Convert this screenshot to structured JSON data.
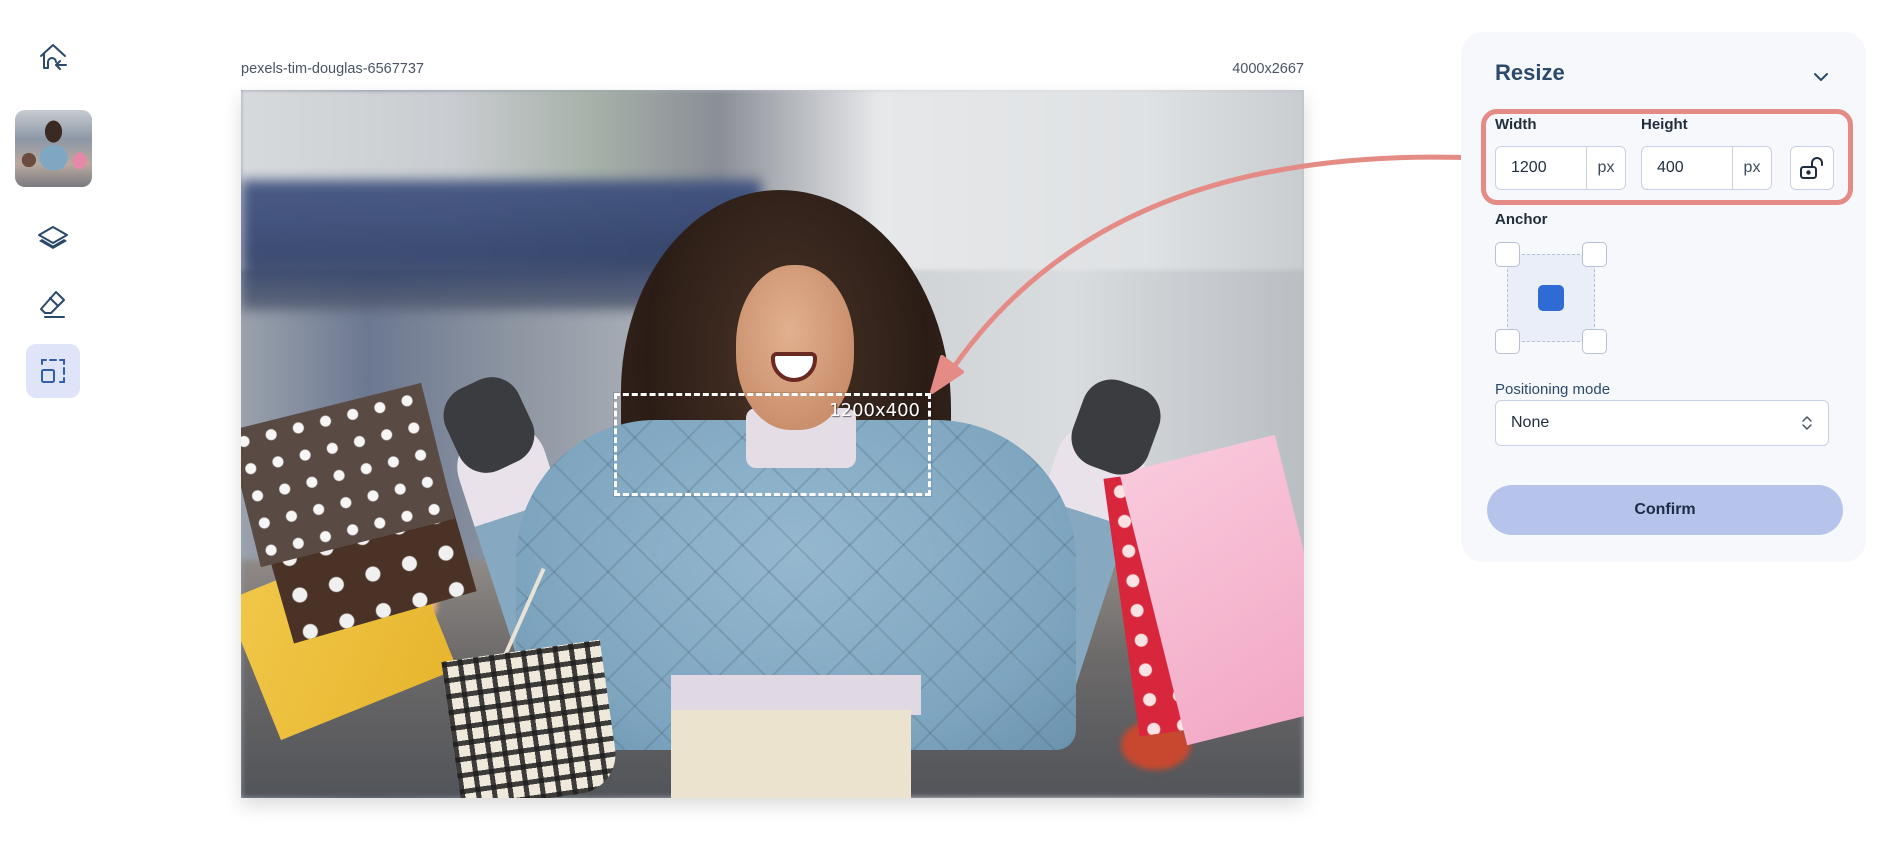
{
  "sidebar": {
    "items": [
      {
        "name": "home-exit",
        "icon": "home-arrow-icon"
      },
      {
        "name": "image-thumbnail",
        "icon": "image-thumbnail"
      },
      {
        "name": "layers",
        "icon": "layers-icon"
      },
      {
        "name": "eraser",
        "icon": "eraser-icon"
      },
      {
        "name": "resize",
        "icon": "resize-select-icon",
        "active": true
      }
    ]
  },
  "canvas": {
    "file_name": "pexels-tim-douglas-6567737",
    "dimensions": "4000x2667",
    "selection_label": "1200x400"
  },
  "panel": {
    "title": "Resize",
    "width_label": "Width",
    "width_value": "1200",
    "width_unit": "px",
    "height_label": "Height",
    "height_value": "400",
    "height_unit": "px",
    "lock_state": "unlocked",
    "anchor_label": "Anchor",
    "anchor_selected": "center",
    "positioning_label": "Positioning mode",
    "positioning_value": "None",
    "confirm_label": "Confirm"
  },
  "colors": {
    "accent": "#2f6bd4",
    "annotation": "#e58b86",
    "confirm_bg": "#b6c4ec",
    "title": "#2b4a6b"
  }
}
